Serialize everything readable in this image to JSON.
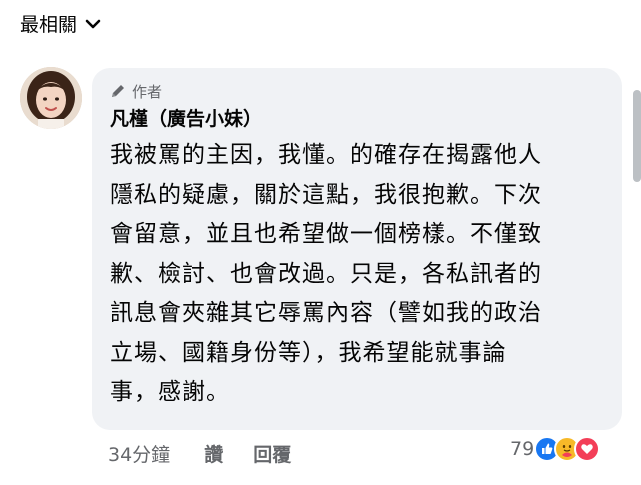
{
  "sort": {
    "label": "最相關"
  },
  "comment": {
    "badge_label": "作者",
    "author": "凡槿（廣告小妹）",
    "lines": [
      "我被罵的主因，我懂。的確存在揭露他人",
      "隱私的疑慮，關於這點，我很抱歉。下次",
      "會留意，並且也希望做一個榜樣。不僅致",
      "歉、檢討、也會改過。只是，各私訊者的",
      "訊息會夾雜其它辱罵內容（譬如我的政治",
      "立場、國籍身份等），我希望能就事論",
      "事，感謝。"
    ],
    "time": "34分鐘",
    "like_label": "讚",
    "reply_label": "回覆",
    "reaction_count": "79",
    "reactions": [
      "like-icon",
      "care-icon",
      "love-icon"
    ]
  },
  "colors": {
    "bubble_bg": "#f0f2f5",
    "secondary_text": "#65676b",
    "like_blue": "#1877f2",
    "care_yellow": "#f7b928",
    "love_red": "#f33e58"
  }
}
